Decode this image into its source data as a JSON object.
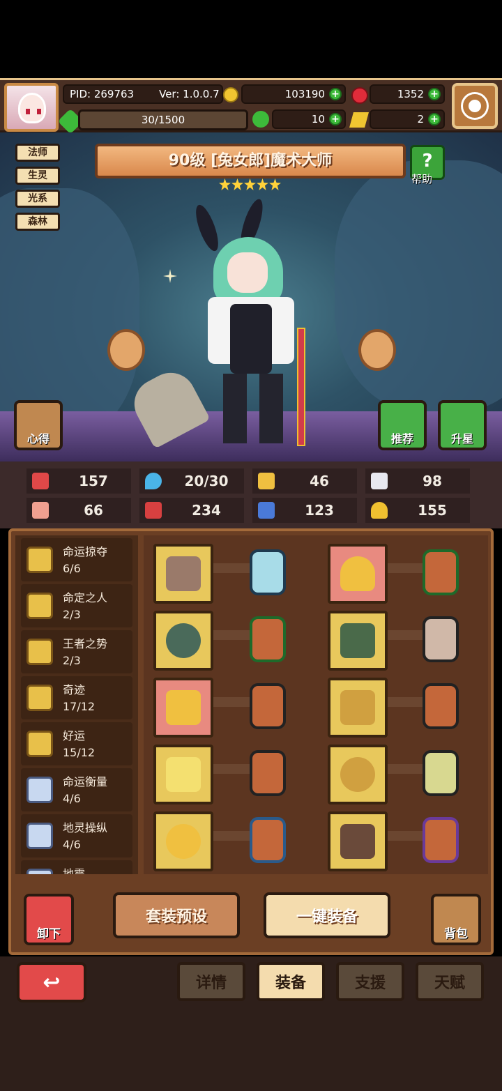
{
  "header": {
    "pid": "PID: 269763",
    "version": "Ver: 1.0.0.7",
    "gold": "103190",
    "gems": "1352",
    "exp": "30/1500",
    "clover": "10",
    "ticket": "2"
  },
  "hero": {
    "tags": [
      "法师",
      "生灵",
      "光系",
      "森林"
    ],
    "title": "90级 [兔女郎]魔术大师",
    "stars": 5,
    "help_label": "帮助",
    "notes_label": "心得",
    "recommend_label": "推荐",
    "upgrade_label": "升星"
  },
  "stats": [
    {
      "icon": "heart-icon",
      "value": "157",
      "color": "#e04848"
    },
    {
      "icon": "mana-drop-icon",
      "value": "20/30",
      "color": "#4ab4e8"
    },
    {
      "icon": "shield-icon",
      "value": "46",
      "color": "#f0c040"
    },
    {
      "icon": "wing-icon",
      "value": "98",
      "color": "#e8e8f0"
    },
    {
      "icon": "fist-icon",
      "value": "66",
      "color": "#f0a090"
    },
    {
      "icon": "spellbook-icon",
      "value": "234",
      "color": "#d84040"
    },
    {
      "icon": "speed-boot-icon",
      "value": "123",
      "color": "#4a7ad8"
    },
    {
      "icon": "horseshoe-icon",
      "value": "155",
      "color": "#f0c030"
    }
  ],
  "sets": [
    {
      "name": "命运掠夺",
      "count": "6/6"
    },
    {
      "name": "命定之人",
      "count": "2/3"
    },
    {
      "name": "王者之势",
      "count": "2/3"
    },
    {
      "name": "奇迹",
      "count": "17/12"
    },
    {
      "name": "好运",
      "count": "15/12"
    },
    {
      "name": "命运衡量",
      "count": "4/6"
    },
    {
      "name": "地灵操纵",
      "count": "4/6"
    },
    {
      "name": "地震",
      "count": ""
    }
  ],
  "buttons": {
    "unequip": "卸下",
    "preset": "套装预设",
    "auto_equip": "一键装备",
    "bag": "背包"
  },
  "tabs": [
    "详情",
    "装备",
    "支援",
    "天赋"
  ]
}
